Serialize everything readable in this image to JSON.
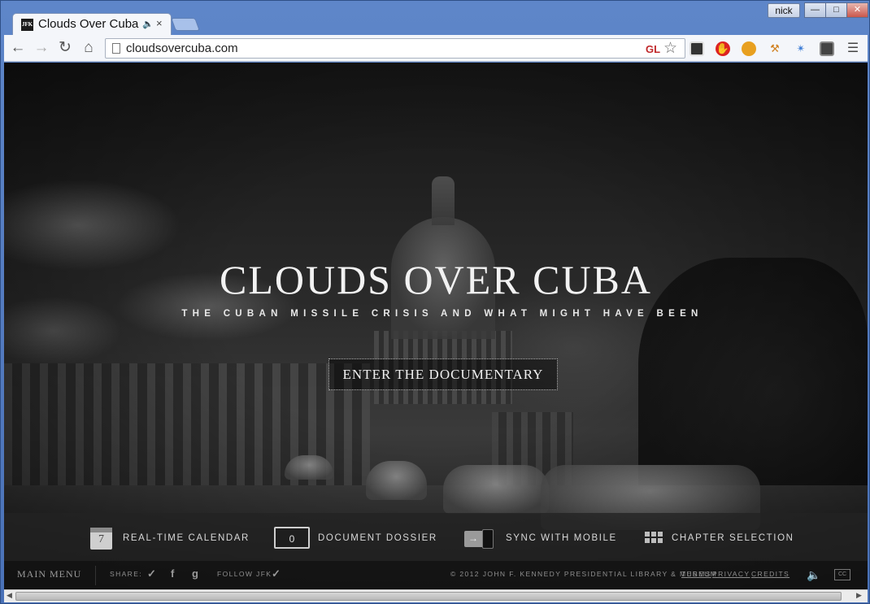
{
  "browser": {
    "tab_title": "Clouds Over Cuba",
    "tab_favicon_text": "JFK",
    "user_name": "nick",
    "url": "cloudsovercuba.com",
    "gl_label": "GL"
  },
  "hero": {
    "title": "CLOUDS OVER CUBA",
    "subtitle": "THE CUBAN MISSILE CRISIS AND WHAT MIGHT HAVE BEEN",
    "enter_label": "ENTER THE DOCUMENTARY"
  },
  "features": {
    "calendar": {
      "label": "REAL-TIME CALENDAR",
      "day": "7",
      "icon": "calendar-icon"
    },
    "dossier": {
      "label": "DOCUMENT DOSSIER",
      "count": "0",
      "icon": "folder-icon"
    },
    "sync": {
      "label": "SYNC WITH MOBILE",
      "icon": "sync-mobile-icon"
    },
    "chapters": {
      "label": "CHAPTER SELECTION",
      "icon": "grid-icon"
    }
  },
  "footer": {
    "main_menu": "MAIN MENU",
    "share_label": "SHARE:",
    "follow_label": "FOLLOW JFK",
    "copyright": "© 2012 JOHN F. KENNEDY PRESIDENTIAL LIBRARY & MUSEUM",
    "terms": "TERMS",
    "privacy": "PRIVACY",
    "credits": "CREDITS"
  },
  "colors": {
    "chrome_frame": "#5e86c9",
    "hero_text": "#f2f2f2",
    "footer_text": "#8e8e8e"
  }
}
